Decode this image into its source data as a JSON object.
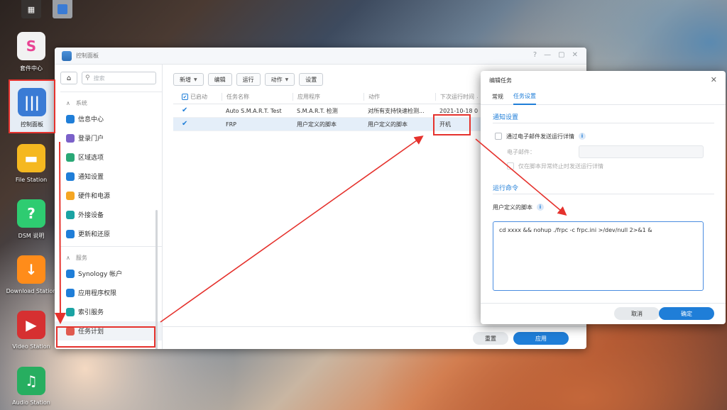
{
  "desktop": {
    "icons": [
      {
        "label": "套件中心",
        "color": "#f2f2f2",
        "glyph": "S"
      },
      {
        "label": "控制面板",
        "color": "#3a7bd5",
        "glyph": "|||"
      },
      {
        "label": "File Station",
        "color": "#f5b820",
        "glyph": "▬"
      },
      {
        "label": "DSM 说明",
        "color": "#2ecc71",
        "glyph": "?"
      },
      {
        "label": "Download Station",
        "color": "#ff8c1a",
        "glyph": "↓"
      },
      {
        "label": "Video Station",
        "color": "#d63031",
        "glyph": "▶"
      },
      {
        "label": "Audio Station",
        "color": "#27ae60",
        "glyph": "♫"
      }
    ]
  },
  "window": {
    "title": "控制面板",
    "controls": {
      "help": "?",
      "minimize": "—",
      "maximize": "▢",
      "close": "✕"
    }
  },
  "sidebar": {
    "search_placeholder": "搜索",
    "section_system": "系统",
    "system_items": [
      "信息中心",
      "登录门户",
      "区域选项",
      "通知设置",
      "硬件和电源",
      "外接设备",
      "更新和还原"
    ],
    "section_services": "服务",
    "service_items": [
      "Synology 帐户",
      "应用程序权限",
      "索引服务",
      "任务计划"
    ]
  },
  "toolbar": {
    "new": "新增",
    "edit": "编辑",
    "run": "运行",
    "action": "动作",
    "settings": "设置"
  },
  "table": {
    "headers": [
      "已启动",
      "任务名称",
      "应用程序",
      "动作",
      "下次运行时间"
    ],
    "rows": [
      {
        "enabled": "✔",
        "name": "Auto S.M.A.R.T. Test",
        "app": "S.M.A.R.T. 检测",
        "action": "对所有支持快速检测...",
        "next": "2021-10-18 0"
      },
      {
        "enabled": "✔",
        "name": "FRP",
        "app": "用户定义的脚本",
        "action": "用户定义的脚本",
        "next": "开机"
      }
    ]
  },
  "footer": {
    "reset": "重置",
    "apply": "应用"
  },
  "dialog": {
    "title": "编辑任务",
    "close": "✕",
    "tabs": [
      "常规",
      "任务设置"
    ],
    "notify_section": "通知设置",
    "email_checkbox_label": "通过电子邮件发送运行详情",
    "email_label": "电子邮件：",
    "email_value": "",
    "abnormal_label": "仅在脚本异常终止时发送运行详情",
    "run_section": "运行命令",
    "script_label": "用户定义的脚本",
    "script": "cd xxxx && nohup ./frpc -c frpc.ini >/dev/null 2>&1 &",
    "cancel": "取消",
    "ok": "确定"
  },
  "colors": {
    "accent": "#1f7ed8",
    "annotation": "#e5322d"
  }
}
